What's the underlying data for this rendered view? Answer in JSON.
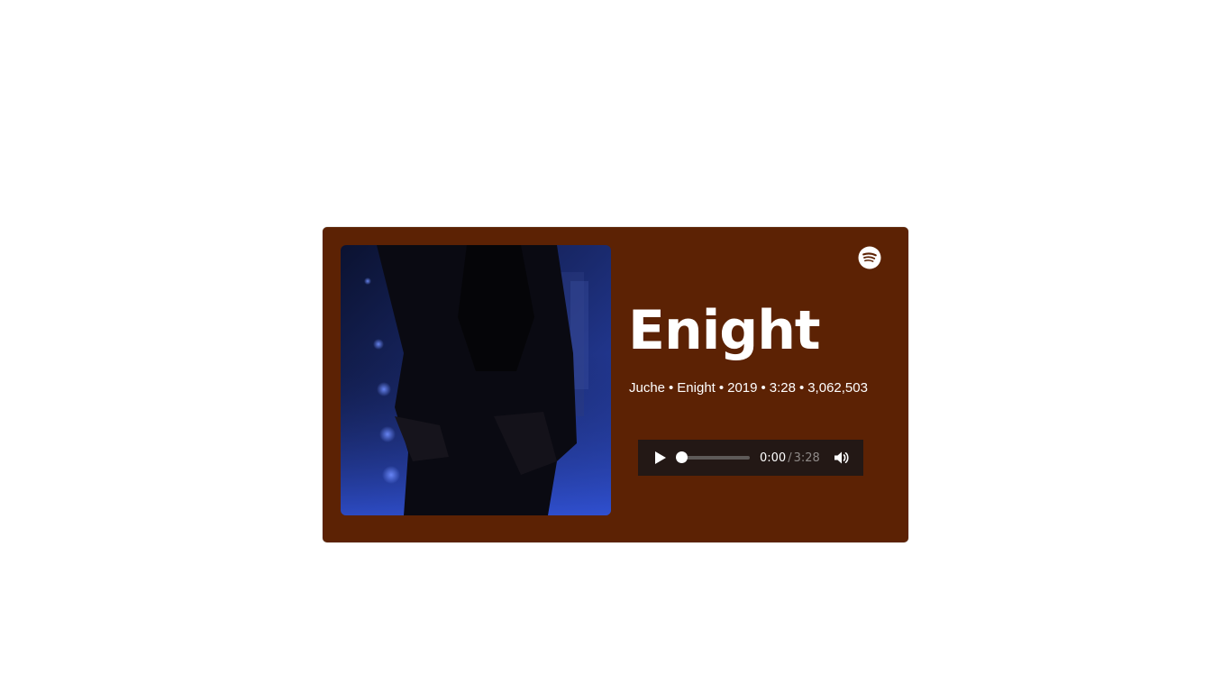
{
  "colors": {
    "card_background": "#5c2204",
    "player_background": "#231815",
    "text": "#ffffff"
  },
  "card": {
    "artwork_icon": "album-cover-image",
    "logo_icon": "spotify-icon"
  },
  "track": {
    "title": "Enight",
    "artist": "Juche",
    "album": "Enight",
    "year": "2019",
    "duration": "3:28",
    "plays": "3,062,503",
    "separator": "•"
  },
  "player": {
    "play_icon": "play-icon",
    "volume_icon": "volume-icon",
    "current_time": "0:00",
    "time_separator": "/",
    "total_time": "3:28",
    "progress": 0.0
  }
}
